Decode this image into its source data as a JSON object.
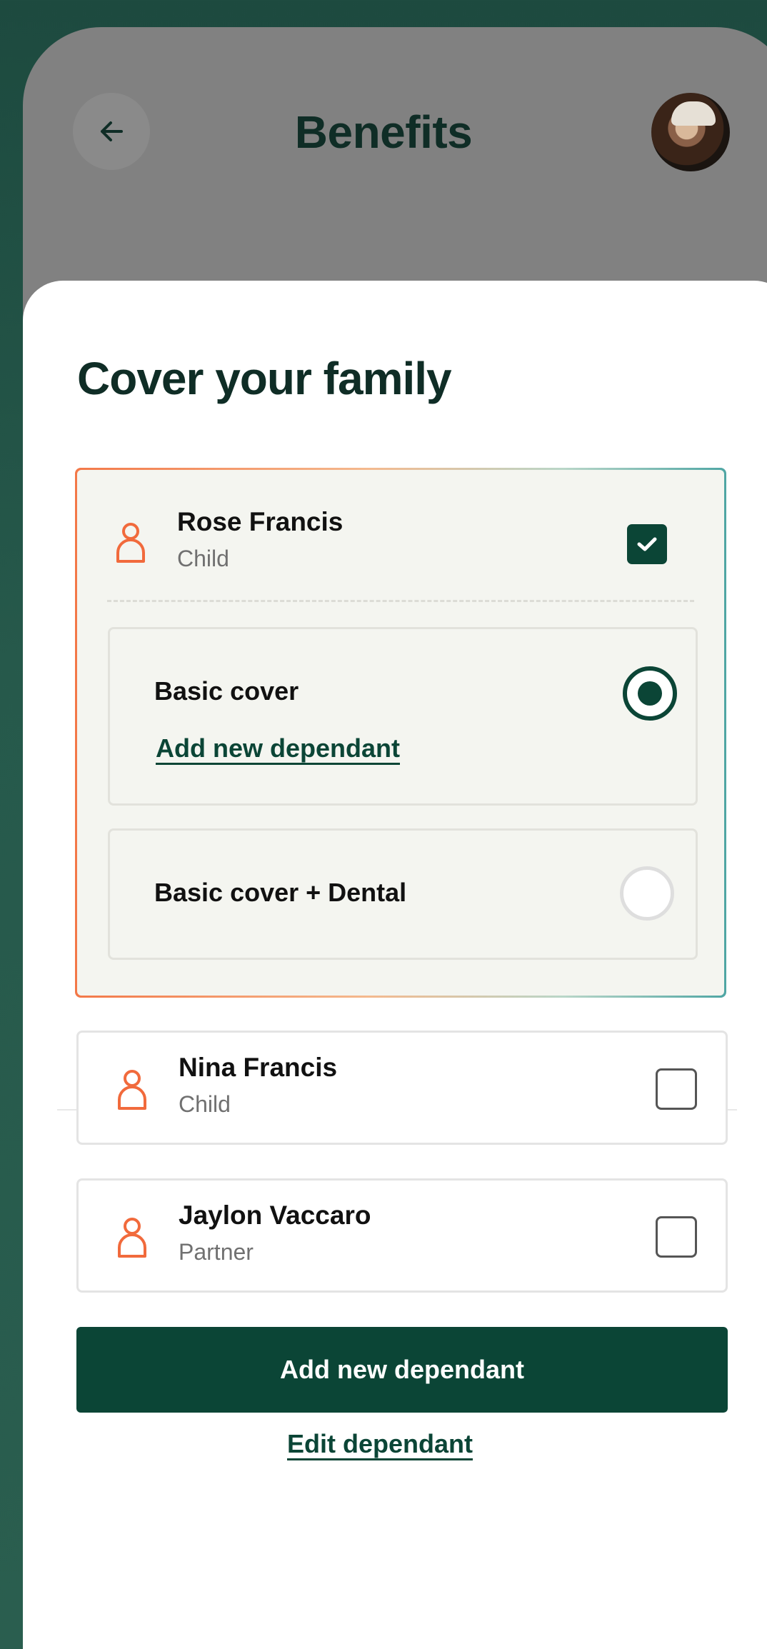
{
  "header": {
    "title": "Benefits",
    "back_icon": "arrow-left-icon",
    "avatar": "user-avatar-photo"
  },
  "sheet": {
    "title": "Cover your family",
    "dependants": [
      {
        "name": "Rose Francis",
        "role": "Child",
        "checked": true,
        "icon": "person-icon",
        "options": [
          {
            "label": "Basic cover",
            "selected": true,
            "link": "Add new dependant"
          },
          {
            "label": "Basic cover + Dental",
            "selected": false
          }
        ]
      },
      {
        "name": "Nina Francis",
        "role": "Child",
        "checked": false,
        "icon": "person-icon"
      },
      {
        "name": "Jaylon Vaccaro",
        "role": "Partner",
        "checked": false,
        "icon": "person-icon"
      }
    ],
    "primary_button": "Add new dependant",
    "secondary_link": "Edit dependant"
  },
  "colors": {
    "brand": "#0b4536",
    "accent_icon": "#f16a3c",
    "title": "#0f2d26",
    "background": "#26594b"
  }
}
